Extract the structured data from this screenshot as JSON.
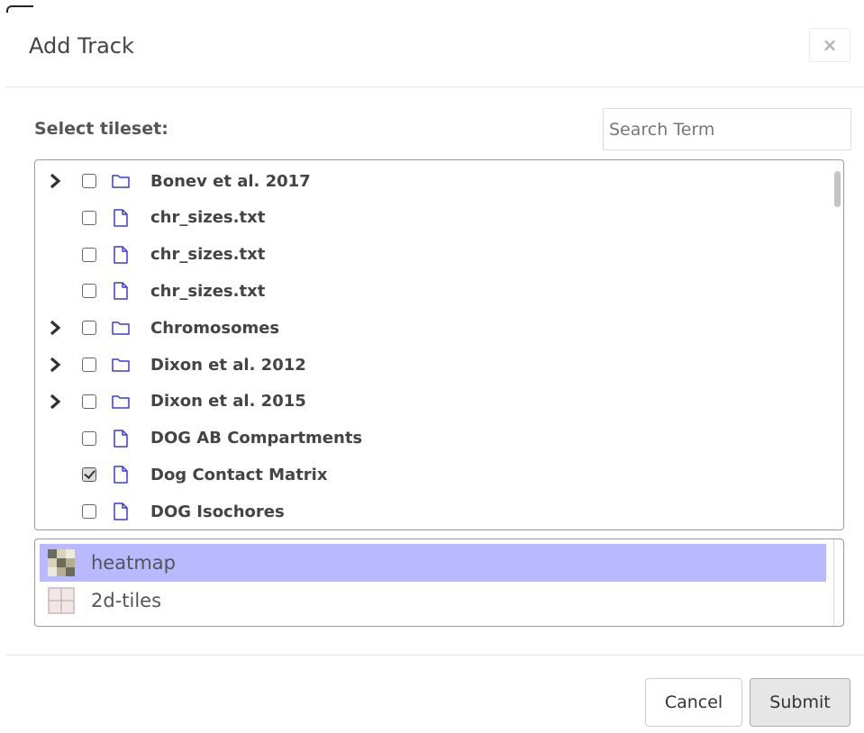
{
  "dialog": {
    "title": "Add Track",
    "close_label": "×"
  },
  "selector": {
    "label": "Select tileset:",
    "search_placeholder": "Search Term",
    "search_value": ""
  },
  "tree": {
    "items": [
      {
        "label": "Bonev et al. 2017",
        "kind": "folder",
        "expandable": true,
        "checked": false
      },
      {
        "label": "chr_sizes.txt",
        "kind": "file",
        "expandable": false,
        "checked": false
      },
      {
        "label": "chr_sizes.txt",
        "kind": "file",
        "expandable": false,
        "checked": false
      },
      {
        "label": "chr_sizes.txt",
        "kind": "file",
        "expandable": false,
        "checked": false
      },
      {
        "label": "Chromosomes",
        "kind": "folder",
        "expandable": true,
        "checked": false
      },
      {
        "label": "Dixon et al. 2012",
        "kind": "folder",
        "expandable": true,
        "checked": false
      },
      {
        "label": "Dixon et al. 2015",
        "kind": "folder",
        "expandable": true,
        "checked": false
      },
      {
        "label": "DOG AB Compartments",
        "kind": "file",
        "expandable": false,
        "checked": false
      },
      {
        "label": "Dog Contact Matrix",
        "kind": "file",
        "expandable": false,
        "checked": true
      },
      {
        "label": "DOG Isochores",
        "kind": "file",
        "expandable": false,
        "checked": false
      }
    ]
  },
  "track_types": {
    "items": [
      {
        "label": "heatmap",
        "icon": "heatmap-thumbnail-icon",
        "selected": true
      },
      {
        "label": "2d-tiles",
        "icon": "2d-tiles-thumbnail-icon",
        "selected": false
      }
    ]
  },
  "footer": {
    "cancel_label": "Cancel",
    "submit_label": "Submit"
  },
  "colors": {
    "icon_blue": "#3b3bd6",
    "selected_bg": "#b8b9ff"
  }
}
